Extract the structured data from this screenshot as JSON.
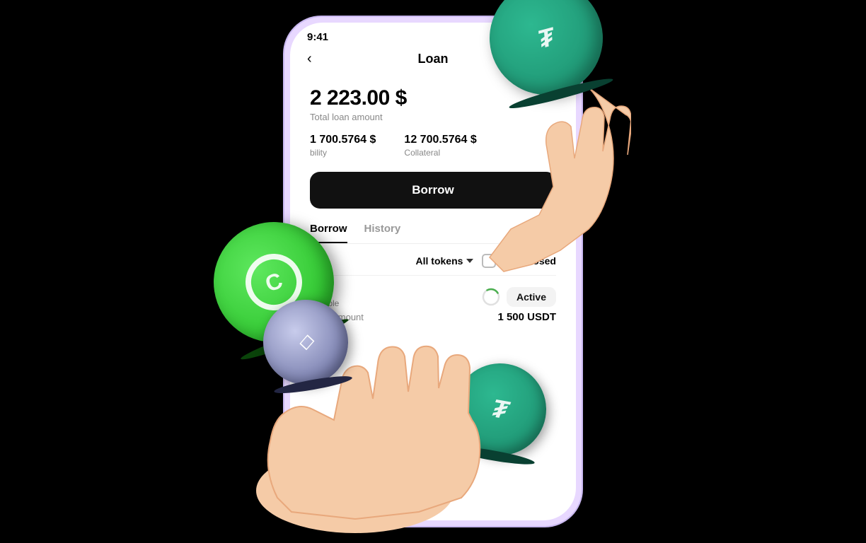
{
  "status_bar": {
    "time": "9:41",
    "signal": "▮▮▮",
    "wifi": "wifi",
    "battery": "battery"
  },
  "nav": {
    "back_icon": "‹",
    "title": "Loan"
  },
  "loan": {
    "total_amount": "2 223.00 $",
    "total_label": "Total loan amount",
    "availability_value": "1 700.5764 $",
    "availability_label": "bility",
    "collateral_value": "12 700.5764 $",
    "collateral_label": "Collateral",
    "borrow_btn": "Borrow",
    "tab_active": "Borrow",
    "tab_inactive": "History",
    "filter_label": "All tokens",
    "hide_closed_label": "Hide closed"
  },
  "loan_item": {
    "coin_name": "ETH",
    "coin_type": "Flexible",
    "status": "Active",
    "amount_label": "Loan amount",
    "amount_value": "1 500 USDT"
  },
  "coins": {
    "tether_symbol": "₮",
    "compound_symbol": "C",
    "eth_symbol": "◇"
  }
}
